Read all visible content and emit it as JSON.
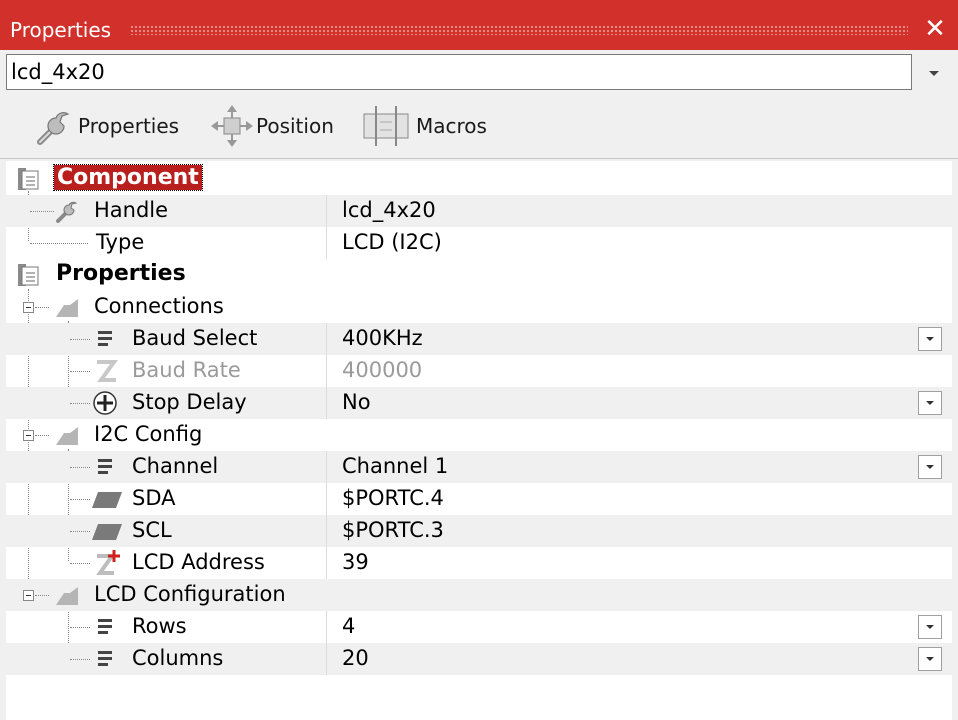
{
  "window": {
    "title": "Properties",
    "close_glyph": "✕"
  },
  "selector": {
    "value": "lcd_4x20"
  },
  "toolbar": [
    {
      "label": "Properties",
      "icon": "wrench-icon"
    },
    {
      "label": "Position",
      "icon": "move-arrows-icon"
    },
    {
      "label": "Macros",
      "icon": "macro-chip-icon"
    }
  ],
  "sections": {
    "component": {
      "title": "Component",
      "rows": [
        {
          "name": "Handle",
          "value": "lcd_4x20"
        },
        {
          "name": "Type",
          "value": "LCD (I2C)"
        }
      ]
    },
    "properties": {
      "title": "Properties",
      "groups": [
        {
          "name": "Connections",
          "rows": [
            {
              "name": "Baud Select",
              "value": "400KHz",
              "dropdown": true
            },
            {
              "name": "Baud Rate",
              "value": "400000",
              "disabled": true
            },
            {
              "name": "Stop Delay",
              "value": "No",
              "dropdown": true
            }
          ]
        },
        {
          "name": "I2C Config",
          "rows": [
            {
              "name": "Channel",
              "value": "Channel 1",
              "dropdown": true
            },
            {
              "name": "SDA",
              "value": "$PORTC.4"
            },
            {
              "name": "SCL",
              "value": "$PORTC.3"
            },
            {
              "name": "LCD Address",
              "value": "39"
            }
          ]
        },
        {
          "name": "LCD Configuration",
          "rows": [
            {
              "name": "Rows",
              "value": "4",
              "dropdown": true
            },
            {
              "name": "Columns",
              "value": "20",
              "dropdown": true
            }
          ]
        }
      ]
    }
  },
  "colors": {
    "titlebar": "#d2312b",
    "selection": "#b9201d",
    "alt_row": "#f0f0f0"
  }
}
